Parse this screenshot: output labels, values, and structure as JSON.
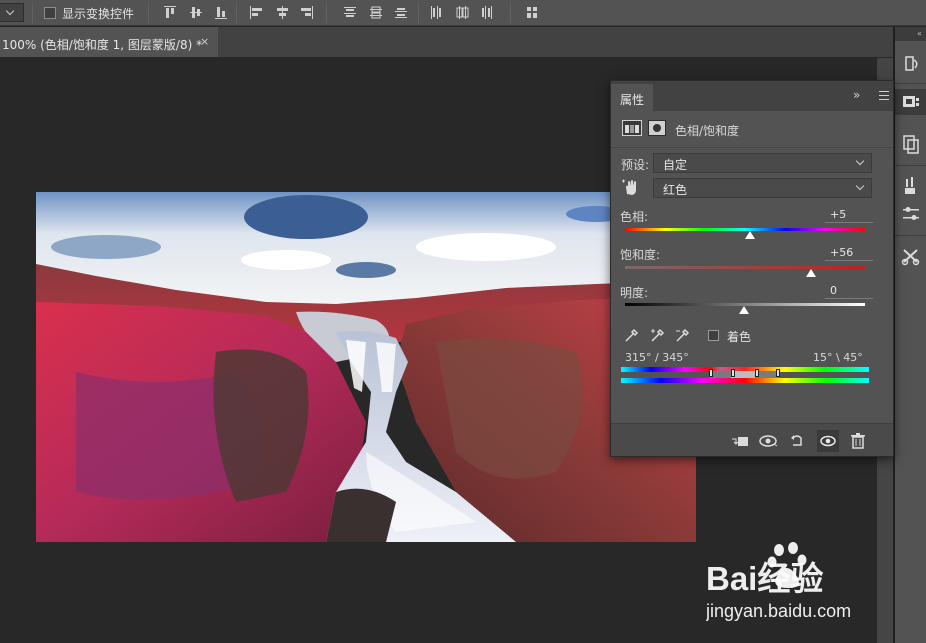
{
  "options_bar": {
    "show_transform_controls_label": "显示变换控件",
    "show_transform_controls_checked": false,
    "align_buttons": [
      "align-top-edges-icon",
      "align-vertical-centers-icon",
      "align-bottom-edges-icon",
      "align-left-edges-icon",
      "align-horizontal-centers-icon",
      "align-right-edges-icon",
      "distribute-top-icon",
      "distribute-vertical-centers-icon",
      "distribute-bottom-icon",
      "distribute-left-icon",
      "distribute-horizontal-centers-icon",
      "distribute-right-icon",
      "auto-align-icon"
    ]
  },
  "document_tab": {
    "title": "100% (色相/饱和度 1, 图层蒙版/8) *",
    "close": "×"
  },
  "properties_panel": {
    "tab_label": "属性",
    "collapse_glyph": "»",
    "adjustment_name": "色相/饱和度",
    "preset_label": "预设:",
    "preset_value": "自定",
    "channel_value": "红色",
    "hue": {
      "label": "色相:",
      "value": "+5"
    },
    "saturation": {
      "label": "饱和度:",
      "value": "+56"
    },
    "lightness": {
      "label": "明度:",
      "value": "0"
    },
    "colorize_label": "着色",
    "colorize_checked": false,
    "range_left": "315° / 345°",
    "range_right": "15° \\ 45°"
  },
  "dock": {
    "items": [
      "history-icon",
      "3d-icon",
      "layer-comps-icon",
      "adjustments-icon",
      "properties-icon",
      "tools-presets-icon"
    ]
  },
  "watermark": {
    "logo_text": "Bai经验",
    "url": "jingyan.baidu.com"
  },
  "colors": {
    "ui_dark": "#282828",
    "panel": "#535353",
    "panel_header": "#424242"
  }
}
